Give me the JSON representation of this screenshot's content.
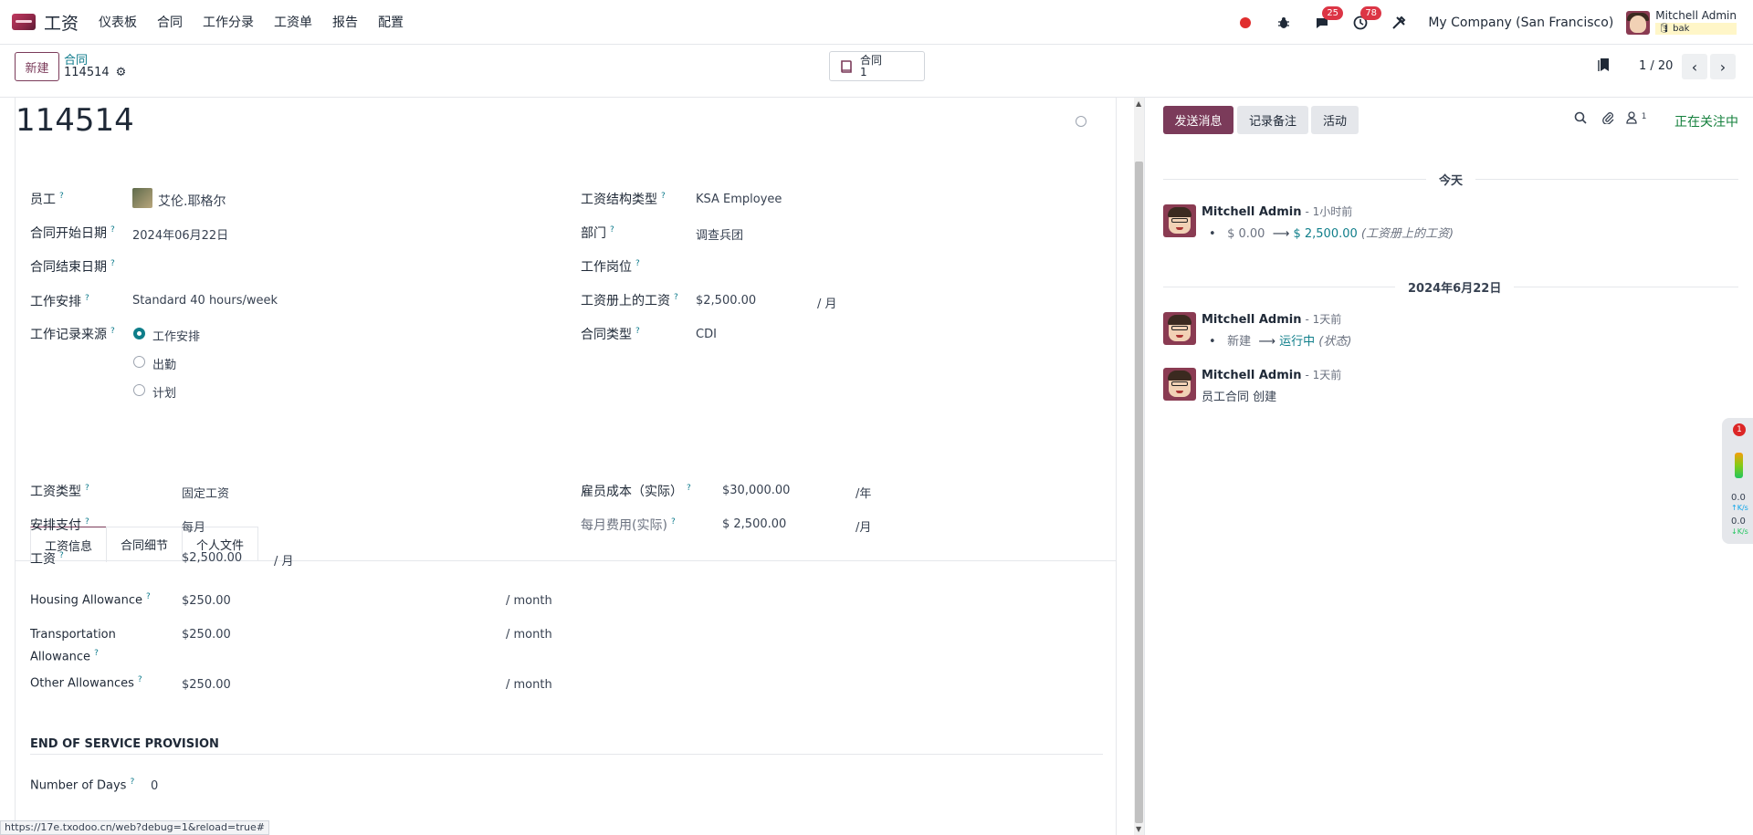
{
  "navbar": {
    "app_name": "工资",
    "menu": [
      "仪表板",
      "合同",
      "工作分录",
      "工资单",
      "报告",
      "配置"
    ],
    "messages_count": "25",
    "activities_count": "78",
    "company": "My Company (San Francisco)",
    "user_name": "Mitchell Admin",
    "db_name": "bak"
  },
  "control": {
    "new_button": "新建",
    "breadcrumb_parent": "合同",
    "breadcrumb_current": "114514",
    "smart_button_label": "合同",
    "smart_button_count": "1",
    "pager": "1 / 20"
  },
  "form": {
    "title": "114514",
    "left": {
      "employee_label": "员工",
      "employee_value": "艾伦.耶格尔",
      "start_label": "合同开始日期",
      "start_value": "2024年06月22日",
      "end_label": "合同结束日期",
      "schedule_label": "工作安排",
      "schedule_value": "Standard 40 hours/week",
      "source_label": "工作记录来源",
      "source_options": [
        "工作安排",
        "出勤",
        "计划"
      ]
    },
    "right": {
      "structure_label": "工资结构类型",
      "structure_value": "KSA Employee",
      "department_label": "部门",
      "department_value": "调查兵团",
      "position_label": "工作岗位",
      "wage_label": "工资册上的工资",
      "wage_value": "$2,500.00",
      "wage_unit": "/ 月",
      "contract_type_label": "合同类型",
      "contract_type_value": "CDI"
    },
    "tabs": [
      "工资信息",
      "合同细节",
      "个人文件"
    ],
    "salary": {
      "wage_type_label": "工资类型",
      "wage_type_value": "固定工资",
      "schedule_pay_label": "安排支付",
      "schedule_pay_value": "每月",
      "wage_label": "工资",
      "wage_value": "$2,500.00",
      "wage_unit": "/ 月",
      "cost_label": "雇员成本（实际）",
      "cost_value": "$30,000.00",
      "cost_unit": "/年",
      "monthly_cost_label": "每月费用(实际)",
      "monthly_cost_value": "$ 2,500.00",
      "monthly_cost_unit": "/月",
      "housing_label": "Housing Allowance",
      "housing_value": "$250.00",
      "housing_unit": "/ month",
      "transport_label_1": "Transportation",
      "transport_label_2": "Allowance",
      "transport_value": "$250.00",
      "transport_unit": "/ month",
      "other_label": "Other Allowances",
      "other_value": "$250.00",
      "other_unit": "/ month",
      "eos_heading": "END OF SERVICE PROVISION",
      "days_label": "Number of Days",
      "days_value": "0"
    },
    "status_url": "https://17e.txodoo.cn/web?debug=1&reload=true#"
  },
  "chatter": {
    "send_message": "发送消息",
    "log_note": "记录备注",
    "activity": "活动",
    "followers_count": "1",
    "following": "正在关注中",
    "today_label": "今天",
    "date_label": "2024年6月22日",
    "messages": [
      {
        "author": "Mitchell Admin",
        "time": "- 1小时前",
        "old": "$ 0.00",
        "arrow": "⟶",
        "new": "$ 2,500.00",
        "field": "(工资册上的工资)"
      },
      {
        "author": "Mitchell Admin",
        "time": "- 1天前",
        "old": "新建",
        "arrow": "⟶",
        "new": "运行中",
        "field": "(状态)"
      },
      {
        "author": "Mitchell Admin",
        "time": "- 1天前",
        "body": "员工合同 创建"
      }
    ]
  },
  "side_widget": {
    "alert_count": "1",
    "up": "0.0",
    "up_unit": "K/s",
    "down": "0.0",
    "down_unit": "K/s"
  }
}
